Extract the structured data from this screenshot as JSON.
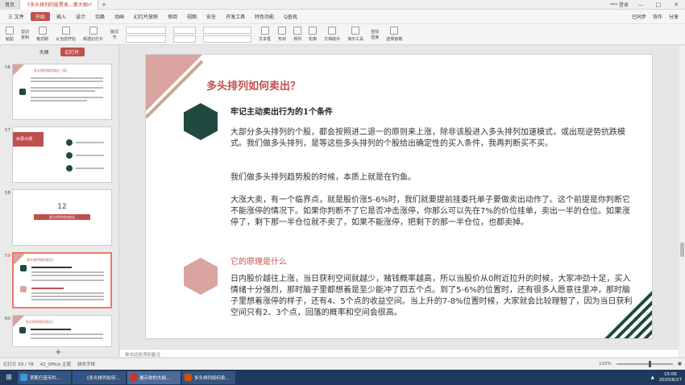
{
  "titlebar": {
    "home_tab": "首页",
    "doc_tab": "《多头排列的股票卖...第大纲(2)(1)",
    "right_text": "*** 登录",
    "close_x": "×",
    "new_tab": "+"
  },
  "menu": {
    "file": "三 文件",
    "items": [
      "开始",
      "插入",
      "设计",
      "切换",
      "动画",
      "幻灯片放映",
      "审阅",
      "视图",
      "安全",
      "开发工具",
      "特色功能",
      "Q查找"
    ],
    "right": [
      "已同步",
      "协作",
      "分享"
    ]
  },
  "toolbar": {
    "paste": "粘贴",
    "cut": "剪切",
    "copy": "复制",
    "format_painter": "格式刷",
    "from_current": "从当前开始",
    "new_slide": "新建幻灯片",
    "layout": "版式",
    "section": "节",
    "text_box": "文本框",
    "shape": "形状",
    "arrange": "排列",
    "outline": "轮廓",
    "doc_helper": "文档助手",
    "presenter": "演示工具",
    "find": "查找",
    "replace": "替换",
    "select_pane": "选择窗格"
  },
  "sidebar": {
    "tabs": [
      "大纲",
      "幻灯片"
    ],
    "slides": [
      {
        "num": "56",
        "title": "多头排列如何卖出（续）"
      },
      {
        "num": "57",
        "title": "目录大纲"
      },
      {
        "num": "58",
        "title": "12",
        "sub": "多头排列如何卖出"
      },
      {
        "num": "59",
        "title": "多头排列如何卖出？"
      },
      {
        "num": "60",
        "title": "多头排列如何卖出？"
      }
    ],
    "add": "+"
  },
  "slide": {
    "title": "多头排列如何卖出？",
    "heading1": "牢记主动卖出行为的1个条件",
    "p1": "大部分多头排列的个股，都会按照进二退一的原则来上涨，除非该股进入多头排列加速模式，或出现逆势抗跌模式。我们做多头排列，是等这些多头排列的个股给出确定性的买入条件，我再判断买不买。",
    "p2": "我们做多头排列趋势股的时候，本质上就是在钓鱼。",
    "p3": "大涨大卖，有一个临界点，就是股价涨5-6%时，我们就要提前挂委托单子要做卖出动作了。这个前提是你判断它不能涨停的情况下。如果你判断不了它是否冲击涨停，你那么可以先在7%的价位挂单，卖出一半的仓位。如果涨停了，剩下那一半仓位就不卖了，如果不能涨停，把剩下的那一半仓位，也都卖掉。",
    "heading2": "它的原理是什么",
    "p4": "日内股价越往上涨，当日获利空间就越少，赌钱概率越高，所以当股价从0附近拉升的时候，大家冲劲十足，买入情绪十分强烈，那时脑子里都想着是至少能冲了四五个点。到了5-6%的位置时，还有很多人愿意往里冲，那时脑子里想着涨停的样子，还有4、5个点的收益空间。当上升的7-8%位置时候，大家就会比较理智了，因为当日获利空间只有2、3个点，回落的概率和空间会很高。"
  },
  "notes": {
    "placeholder": "单击此处添加备注"
  },
  "status": {
    "slide_info": "幻灯片 59 / 78",
    "theme": "42_Office 主题",
    "missing_font": "缺失字体",
    "zoom": "110%"
  },
  "taskbar": {
    "tasks": [
      "贾斯打造专栏...",
      "《多头排列如何...",
      "展示你的大纲...",
      "多头排列如何卖..."
    ],
    "time": "15:06",
    "date": "2020/6/27"
  },
  "colors": {
    "accent": "#c0504d",
    "pink": "#d9a3a0",
    "dark_green": "#1f4a3f",
    "tan": "#c7a98d"
  }
}
